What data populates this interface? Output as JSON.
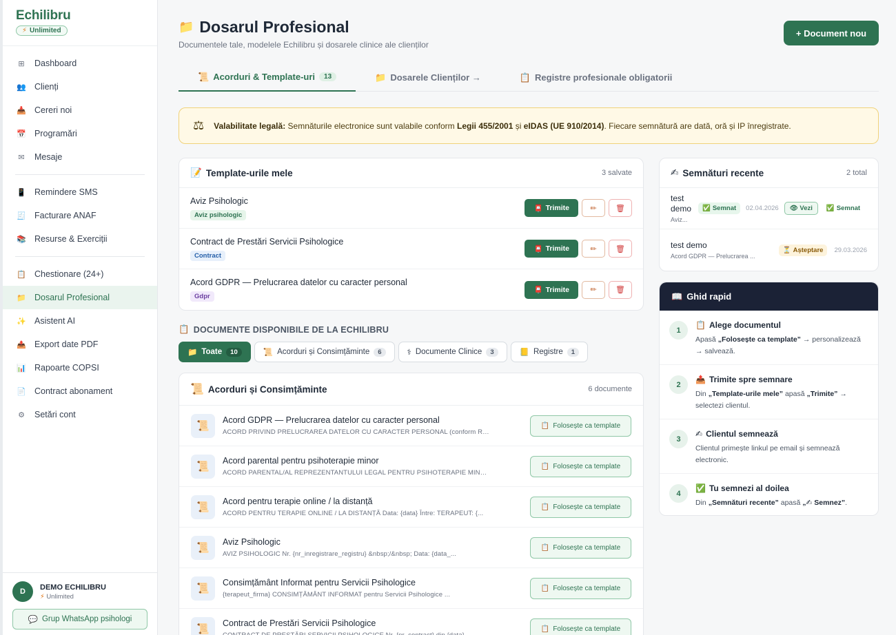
{
  "app": {
    "brand": "Echilibru",
    "plan_badge": "Unlimited"
  },
  "sidebar": {
    "groups": [
      [
        {
          "label": "Dashboard",
          "icon": "grid-icon"
        },
        {
          "label": "Clienți",
          "icon": "users-icon"
        },
        {
          "label": "Cereri noi",
          "icon": "inbox-icon"
        },
        {
          "label": "Programări",
          "icon": "calendar-icon"
        },
        {
          "label": "Mesaje",
          "icon": "mail-icon"
        }
      ],
      [
        {
          "label": "Remindere SMS",
          "icon": "sms-icon"
        },
        {
          "label": "Facturare ANAF",
          "icon": "invoice-icon"
        },
        {
          "label": "Resurse & Exerciții",
          "icon": "books-icon"
        }
      ],
      [
        {
          "label": "Chestionare (24+)",
          "icon": "clipboard-icon"
        },
        {
          "label": "Dosarul Profesional",
          "icon": "folder-icon",
          "active": true
        },
        {
          "label": "Asistent AI",
          "icon": "sparkles-icon"
        },
        {
          "label": "Export date PDF",
          "icon": "export-icon"
        },
        {
          "label": "Rapoarte COPSI",
          "icon": "chart-icon"
        },
        {
          "label": "Contract abonament",
          "icon": "contract-icon"
        },
        {
          "label": "Setări cont",
          "icon": "gear-icon"
        }
      ]
    ],
    "user": {
      "initial": "D",
      "name": "DEMO ECHILIBRU",
      "plan": "Unlimited"
    },
    "whatsapp_label": "Grup WhatsApp psihologi"
  },
  "header": {
    "title": "Dosarul Profesional",
    "subtitle": "Documentele tale, modelele Echilibru și dosarele clinice ale clienților",
    "new_doc_label": "+ Document nou"
  },
  "tabs": [
    {
      "label": "Acorduri & Template-uri",
      "count": "13",
      "icon": "scroll-icon",
      "active": true
    },
    {
      "label": "Dosarele Clienților →",
      "icon": "folder-icon"
    },
    {
      "label": "Registre profesionale obligatorii",
      "icon": "clipboard-icon"
    }
  ],
  "legal": {
    "label": "Valabilitate legală:",
    "text1": " Semnăturile electronice sunt valabile conform ",
    "law1": "Legii 455/2001",
    "text2": " și ",
    "law2": "eIDAS (UE 910/2014)",
    "text3": ". Fiecare semnătură are dată, oră și IP înregistrate."
  },
  "templates": {
    "title": "Template-urile mele",
    "meta": "3 salvate",
    "send_label": "Trimite",
    "items": [
      {
        "name": "Aviz Psihologic",
        "tag": "Aviz psihologic",
        "tag_color": "green"
      },
      {
        "name": "Contract de Prestări Servicii Psihologice",
        "tag": "Contract",
        "tag_color": "blue"
      },
      {
        "name": "Acord GDPR — Prelucrarea datelor cu caracter personal",
        "tag": "Gdpr",
        "tag_color": "purple"
      }
    ]
  },
  "library": {
    "section_label": "DOCUMENTE DISPONIBILE DE LA ECHILIBRU",
    "filters": [
      {
        "label": "Toate",
        "count": "10",
        "icon": "folder-icon",
        "active": true
      },
      {
        "label": "Acorduri și Consimțăminte",
        "count": "6",
        "icon": "scroll-icon"
      },
      {
        "label": "Documente Clinice",
        "count": "3",
        "icon": "stethoscope-icon"
      },
      {
        "label": "Registre",
        "count": "1",
        "icon": "notebook-icon"
      }
    ],
    "group_title": "Acorduri și Consimțăminte",
    "group_meta": "6 documente",
    "use_label": "Folosește ca template",
    "docs": [
      {
        "title": "Acord GDPR — Prelucrarea datelor cu caracter personal",
        "preview": "ACORD PRIVIND PRELUCRAREA DATELOR CU CARACTER PERSONAL (conform Regul..."
      },
      {
        "title": "Acord parental pentru psihoterapie minor",
        "preview": "ACORD PARENTAL/AL REPREZENTANTULUI LEGAL PENTRU PSIHOTERAPIE MINOR D..."
      },
      {
        "title": "Acord pentru terapie online / la distanță",
        "preview": "ACORD PENTRU TERAPIE ONLINE / LA DISTANȚĂ Data: {data} Între: TERAPEUT: {..."
      },
      {
        "title": "Aviz Psihologic",
        "preview": "AVIZ PSIHOLOGIC Nr. {nr_inregistrare_registru} &nbsp;/&nbsp; Data: {data_..."
      },
      {
        "title": "Consimțământ Informat pentru Servicii Psihologice",
        "preview": "{terapeut_firma} CONSIMȚĂMÂNT INFORMAT pentru Servicii Psihologice ..."
      },
      {
        "title": "Contract de Prestări Servicii Psihologice",
        "preview": "CONTRACT DE PRESTĂRI SERVICII PSIHOLOGICE Nr. {nr_contract} din {data}"
      }
    ]
  },
  "signatures": {
    "title": "Semnături recente",
    "meta": "2 total",
    "items": [
      {
        "client": "test demo",
        "doc": "Aviz...",
        "status": "Semnat",
        "date": "02.04.2026",
        "view": "Vezi",
        "own_status": "Semnat"
      },
      {
        "client": "test demo",
        "doc": "Acord GDPR — Prelucrarea ...",
        "status": "Așteptare",
        "date": "29.03.2026"
      }
    ]
  },
  "guide": {
    "title": "Ghid rapid",
    "steps": [
      {
        "num": "1",
        "icon": "clipboard-icon",
        "title": "Alege documentul",
        "parts": [
          "Apasă ",
          "„Folosește ca template”",
          " → personalizează → salvează."
        ]
      },
      {
        "num": "2",
        "icon": "outbox-icon",
        "title": "Trimite spre semnare",
        "parts": [
          "Din ",
          "„Template-urile mele”",
          " apasă ",
          "„Trimite”",
          " → selectezi clientul."
        ]
      },
      {
        "num": "3",
        "icon": "pen-icon",
        "title": "Clientul semnează",
        "parts": [
          "Clientul primește linkul pe email și semnează electronic."
        ]
      },
      {
        "num": "4",
        "icon": "check-icon",
        "title": "Tu semnezi al doilea",
        "parts": [
          "Din ",
          "„Semnături recente”",
          " apasă ",
          "„✍ Semnez”",
          "."
        ]
      }
    ]
  },
  "colors": {
    "brand": "#2e7352",
    "guide_header": "#1b2236",
    "legal_bg": "#fff9e6"
  }
}
